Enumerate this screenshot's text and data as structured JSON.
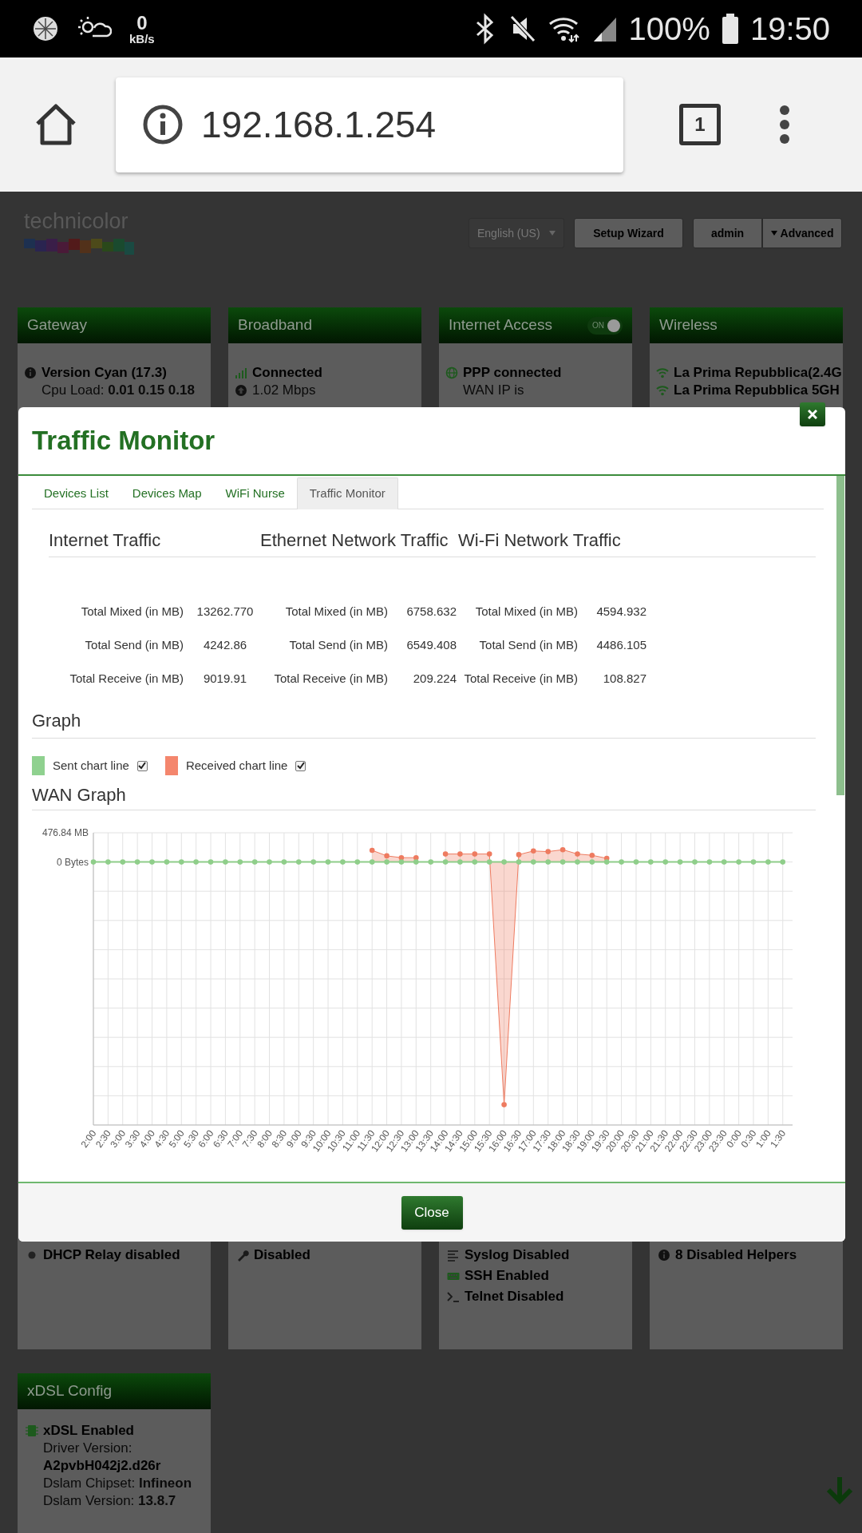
{
  "status_bar": {
    "net_speed_value": "0",
    "net_speed_unit": "kB/s",
    "battery": "100%",
    "time": "19:50"
  },
  "browser": {
    "url": "192.168.1.254",
    "tab_count": "1"
  },
  "header": {
    "logo": "technicolor",
    "language": "English (US)",
    "setup_wizard": "Setup Wizard",
    "user": "admin",
    "advanced": "Advanced"
  },
  "cards": [
    {
      "title": "Gateway",
      "top_lines": [
        {
          "kind": "info",
          "text": "Version Cyan (17.3)",
          "bold": true
        },
        {
          "kind": "plain",
          "text": "Cpu Load: **0.01 0.15 0.18**",
          "bold": false
        }
      ],
      "bottom_lines": [
        {
          "kind": "dot",
          "text": "DHCP Relay disabled",
          "bold": true
        }
      ]
    },
    {
      "title": "Broadband",
      "top_lines": [
        {
          "kind": "signal",
          "text": "Connected",
          "bold": true
        },
        {
          "kind": "upload",
          "text": "1.02 Mbps",
          "bold": false
        }
      ],
      "bottom_lines": [
        {
          "kind": "wrench",
          "text": "Disabled",
          "bold": true
        }
      ]
    },
    {
      "title": "Internet Access",
      "toggle": {
        "label": "ON",
        "on": true
      },
      "top_lines": [
        {
          "kind": "globe",
          "text": "PPP connected",
          "bold": true
        },
        {
          "kind": "plain",
          "text": "WAN IP is",
          "bold": false
        }
      ],
      "bottom_lines": [
        {
          "kind": "list",
          "text": "Syslog Disabled",
          "bold": true
        },
        {
          "kind": "keyboard",
          "text": "SSH Enabled",
          "bold": true
        },
        {
          "kind": "terminal",
          "text": "Telnet Disabled",
          "bold": true
        }
      ]
    },
    {
      "title": "Wireless",
      "top_lines": [
        {
          "kind": "wifi",
          "text": "La Prima Repubblica(2.4G",
          "bold": true
        },
        {
          "kind": "wifi",
          "text": "La Prima Repubblica 5GH",
          "bold": true
        }
      ],
      "bottom_lines": [
        {
          "kind": "info",
          "text": "8 Disabled Helpers",
          "bold": true
        }
      ]
    }
  ],
  "xdsl_card": {
    "title": "xDSL Config",
    "lines": [
      {
        "kind": "chip",
        "text": "xDSL Enabled",
        "bold": true
      },
      {
        "kind": "plain",
        "text": "Driver Version:",
        "bold": false
      },
      {
        "kind": "plain",
        "text": "A2pvbH042j2.d26r",
        "bold": true
      },
      {
        "kind": "plain",
        "text": "Dslam Chipset: **Infineon**",
        "bold": false
      },
      {
        "kind": "plain",
        "text": "Dslam Version: **13.8.7**",
        "bold": false
      }
    ]
  },
  "modal": {
    "title": "Traffic Monitor",
    "tabs": [
      {
        "label": "Devices List",
        "selected": false
      },
      {
        "label": "Devices Map",
        "selected": false
      },
      {
        "label": "WiFi Nurse",
        "selected": false
      },
      {
        "label": "Traffic Monitor",
        "selected": true
      }
    ],
    "sections": [
      {
        "heading": "Internet Traffic",
        "rows": [
          {
            "label": "Total Mixed (in MB)",
            "value": "13262.770"
          },
          {
            "label": "Total Send (in MB)",
            "value": "4242.86"
          },
          {
            "label": "Total Receive (in MB)",
            "value": "9019.91"
          }
        ]
      },
      {
        "heading": "Ethernet Network Traffic",
        "rows": [
          {
            "label": "Total Mixed (in MB)",
            "value": "6758.632"
          },
          {
            "label": "Total Send (in MB)",
            "value": "6549.408"
          },
          {
            "label": "Total Receive (in MB)",
            "value": "209.224"
          }
        ]
      },
      {
        "heading": "Wi-Fi Network Traffic",
        "rows": [
          {
            "label": "Total Mixed (in MB)",
            "value": "4594.932"
          },
          {
            "label": "Total Send (in MB)",
            "value": "4486.105"
          },
          {
            "label": "Total Receive (in MB)",
            "value": "108.827"
          }
        ]
      }
    ],
    "graph_heading": "Graph",
    "legend": [
      {
        "label": "Sent chart line",
        "color": "#8fd18f",
        "checked": true
      },
      {
        "label": "Received chart line",
        "color": "#f4866d",
        "checked": true
      }
    ],
    "wan_heading": "WAN Graph",
    "chart_data": {
      "type": "area",
      "ylim": [
        -4291.56,
        476.84
      ],
      "yticks": [
        {
          "value": 476.84,
          "label": "476.84 MB"
        },
        {
          "value": 0,
          "label": "0 Bytes"
        }
      ],
      "categories": [
        "2:00",
        "2:30",
        "3:00",
        "3:30",
        "4:00",
        "4:30",
        "5:00",
        "5:30",
        "6:00",
        "6:30",
        "7:00",
        "7:30",
        "8:00",
        "8:30",
        "9:00",
        "9:30",
        "10:00",
        "10:30",
        "11:00",
        "11:30",
        "12:00",
        "12:30",
        "13:00",
        "13:30",
        "14:00",
        "14:30",
        "15:00",
        "15:30",
        "16:00",
        "16:30",
        "17:00",
        "17:30",
        "18:00",
        "18:30",
        "19:00",
        "19:30",
        "20:00",
        "20:30",
        "21:00",
        "21:30",
        "22:00",
        "22:30",
        "23:00",
        "23:30",
        "0:00",
        "0:30",
        "1:00",
        "1:30"
      ],
      "series": [
        {
          "color": "#ee7b60",
          "marker": "circle",
          "values": [
            null,
            null,
            null,
            null,
            null,
            null,
            null,
            null,
            null,
            null,
            null,
            null,
            null,
            null,
            null,
            null,
            null,
            null,
            null,
            190,
            100,
            70,
            70,
            null,
            130,
            130,
            130,
            130,
            -3960,
            120,
            180,
            170,
            200,
            130,
            110,
            60,
            null,
            null,
            null,
            null,
            null,
            null,
            null,
            null,
            null,
            null,
            null,
            null
          ]
        },
        {
          "color": "#8fce8a",
          "type": "line",
          "marker": "circle",
          "values": [
            0,
            0,
            0,
            0,
            0,
            0,
            0,
            0,
            0,
            0,
            0,
            0,
            0,
            0,
            0,
            0,
            0,
            0,
            0,
            0,
            0,
            0,
            0,
            0,
            0,
            0,
            0,
            0,
            0,
            0,
            0,
            0,
            0,
            0,
            0,
            0,
            0,
            0,
            0,
            0,
            0,
            0,
            0,
            0,
            0,
            0,
            0,
            0
          ]
        }
      ]
    },
    "close_button": "Close"
  }
}
